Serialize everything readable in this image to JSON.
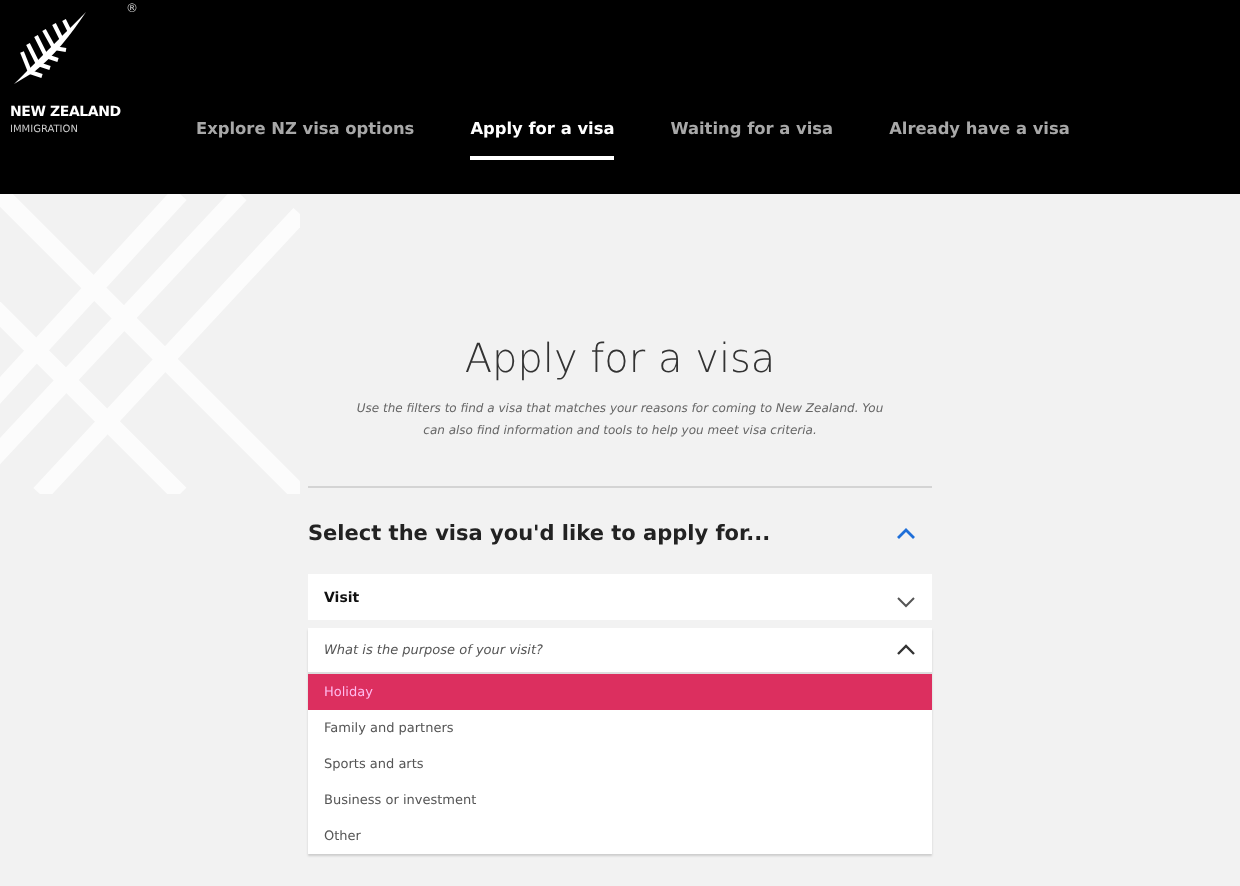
{
  "logo": {
    "line1": "NEW ZEALAND",
    "line2": "IMMIGRATION",
    "registered": "®"
  },
  "nav": [
    {
      "label": "Explore NZ visa options",
      "selected": false
    },
    {
      "label": "Apply for a visa",
      "selected": true
    },
    {
      "label": "Waiting for a visa",
      "selected": false
    },
    {
      "label": "Already have a visa",
      "selected": false
    }
  ],
  "title": "Apply for a visa",
  "intro": "Use the filters to find a visa that matches your reasons for coming to New Zealand. You can also find information and tools to help you meet visa criteria.",
  "section": {
    "heading": "Select the visa you'd like to apply for...",
    "expanded": true
  },
  "visa_type": {
    "value": "Visit",
    "expanded": false
  },
  "purpose": {
    "placeholder": "What is the purpose of your visit?",
    "expanded": true,
    "options": [
      {
        "label": "Holiday",
        "selected": true
      },
      {
        "label": "Family and partners",
        "selected": false
      },
      {
        "label": "Sports and arts",
        "selected": false
      },
      {
        "label": "Business or investment",
        "selected": false
      },
      {
        "label": "Other",
        "selected": false
      }
    ]
  }
}
